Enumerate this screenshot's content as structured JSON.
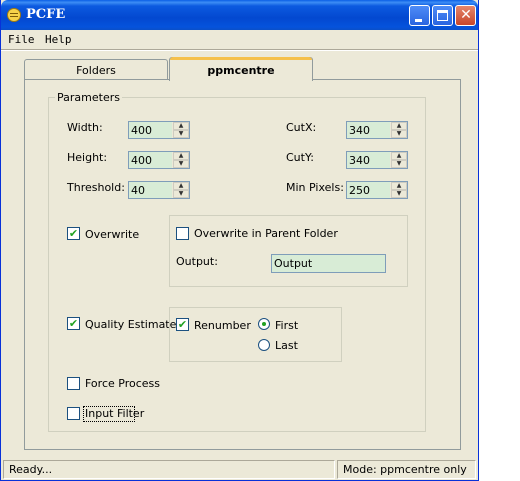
{
  "window": {
    "title": "PCFE"
  },
  "menu": {
    "file": "File",
    "help": "Help"
  },
  "tabs": [
    {
      "label": "Folders",
      "selected": false
    },
    {
      "label": "ppmcentre",
      "selected": true
    }
  ],
  "parameters": {
    "legend": "Parameters",
    "width": {
      "label": "Width:",
      "value": "400"
    },
    "height": {
      "label": "Height:",
      "value": "400"
    },
    "threshold": {
      "label": "Threshold:",
      "value": "40"
    },
    "cutx": {
      "label": "CutX:",
      "value": "340"
    },
    "cuty": {
      "label": "CutY:",
      "value": "340"
    },
    "min_pixels": {
      "label": "Min Pixels:",
      "value": "250"
    }
  },
  "options": {
    "overwrite": {
      "label": "Overwrite",
      "checked": true
    },
    "overwrite_parent": {
      "label": "Overwrite in Parent Folder",
      "checked": false
    },
    "output": {
      "label": "Output:",
      "value": "Output"
    },
    "quality_estimate": {
      "label": "Quality Estimate",
      "checked": true
    },
    "renumber": {
      "label": "Renumber",
      "checked": true
    },
    "first": {
      "label": "First",
      "selected": true
    },
    "last": {
      "label": "Last",
      "selected": false
    },
    "force_process": {
      "label": "Force Process",
      "checked": false
    },
    "input_filter": {
      "label": "Input Filter",
      "checked": false
    }
  },
  "status": {
    "left": "Ready...",
    "right": "Mode: ppmcentre only"
  },
  "icons": {
    "check_mark": "✔",
    "spin_up": "▲",
    "spin_down": "▼",
    "close": "✕"
  },
  "colors": {
    "titlebar": "#0348d0",
    "field_background": "#d8ecd6",
    "window_background": "#ece9d8"
  }
}
